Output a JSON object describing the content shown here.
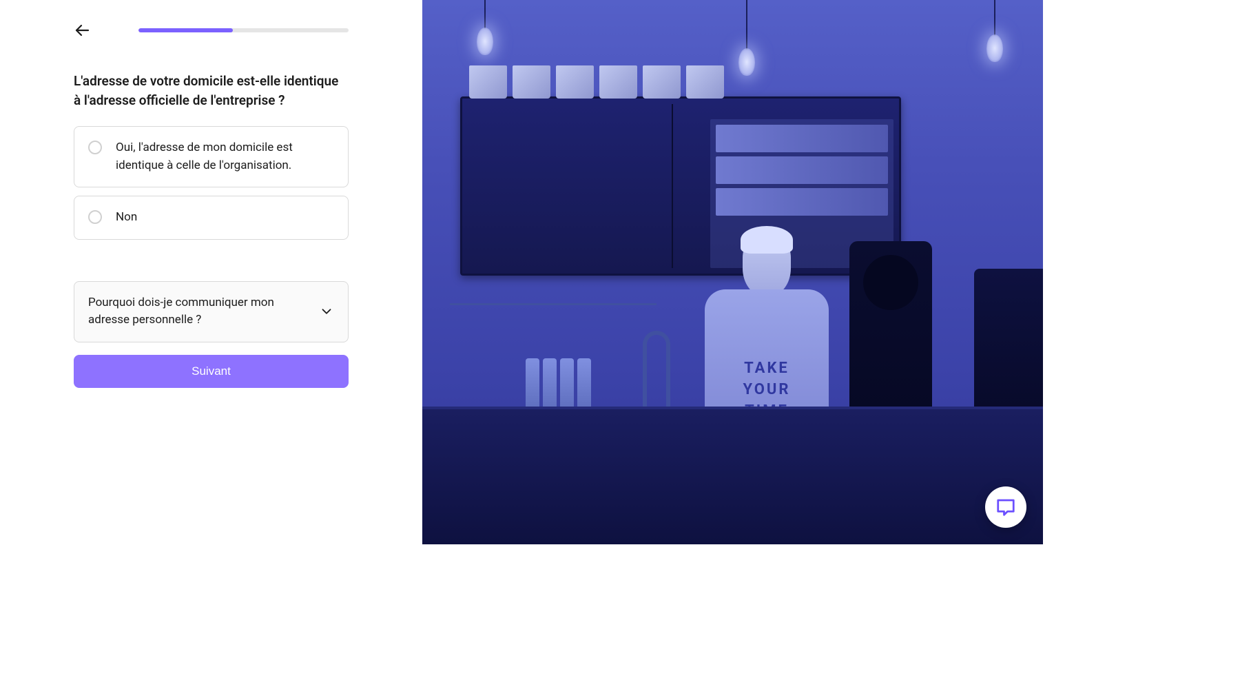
{
  "progress": {
    "percent": 45
  },
  "question": {
    "title": "L'adresse de votre domicile est-elle identique à l'adresse officielle de l'entreprise ?",
    "options": [
      {
        "label": "Oui, l'adresse de mon domicile est identique à celle de l'organisation."
      },
      {
        "label": "Non"
      }
    ]
  },
  "accordion": {
    "label": "Pourquoi dois-je communiquer mon adresse personnelle ?"
  },
  "buttons": {
    "next": "Suivant"
  },
  "image": {
    "shirt_line1": "TAKE",
    "shirt_line2": "YOUR",
    "shirt_line3": "TIME"
  },
  "colors": {
    "primary": "#7b61ff",
    "button": "#8e72ff",
    "overlay": "#3b3fa8"
  }
}
